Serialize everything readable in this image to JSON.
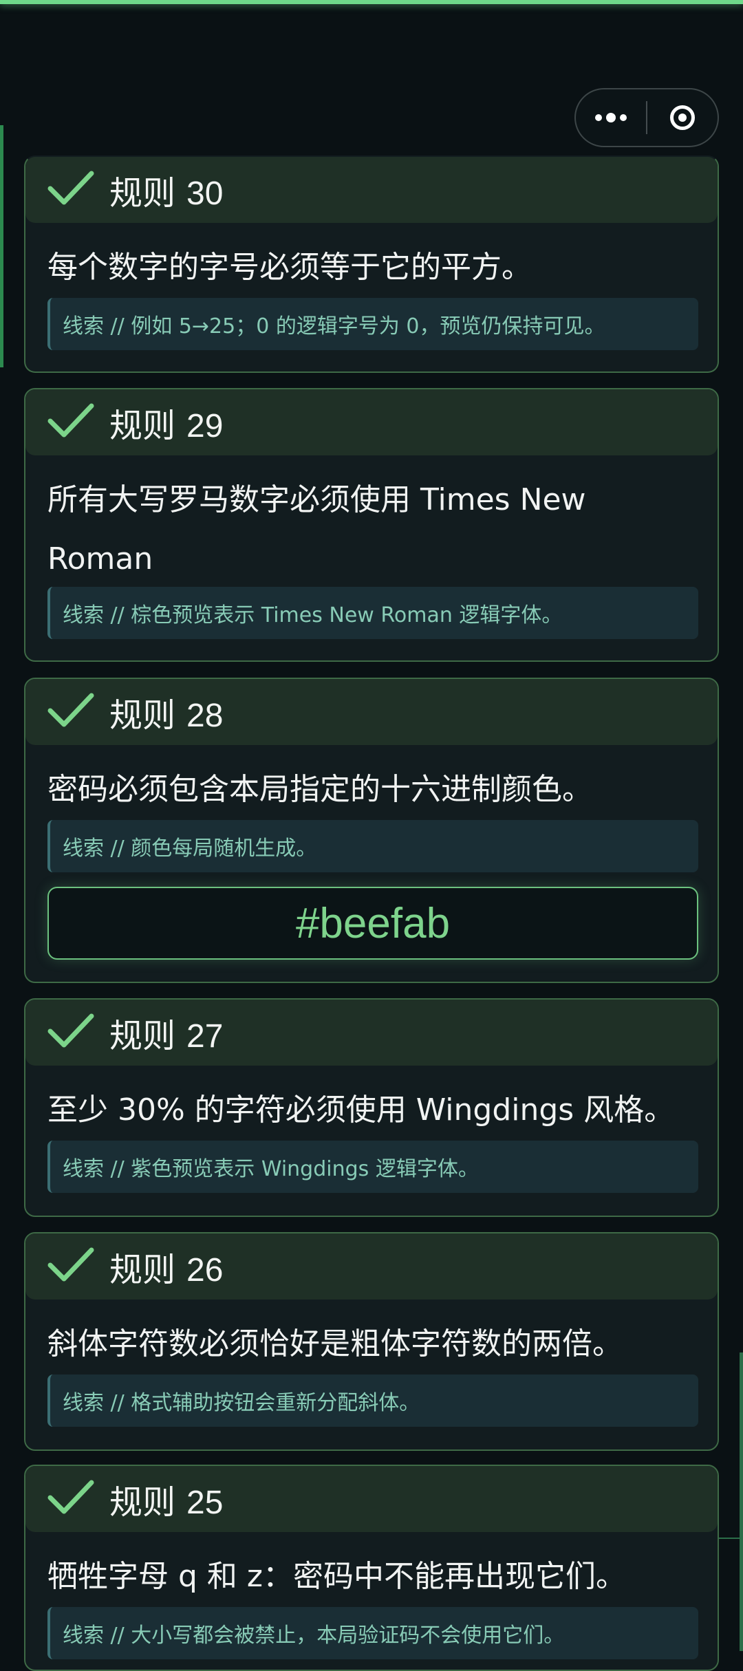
{
  "menu": {
    "more_icon": "more-dots-icon",
    "close_icon": "target-circle-icon"
  },
  "colors": {
    "accent": "#6fd98a",
    "card_bg": "#121c1f",
    "header_bg": "#1f3026",
    "clue_text": "#88cbb6"
  },
  "rules": [
    {
      "label": "规则",
      "number": "30",
      "text": "每个数字的字号必须等于它的平方。",
      "clue": "线索 // 例如 5→25；0 的逻辑字号为 0，预览仍保持可见。"
    },
    {
      "label": "规则",
      "number": "29",
      "text": "所有大写罗马数字必须使用 Times New Roman",
      "text_cont": "。",
      "clue": "线索 // 棕色预览表示 Times New Roman 逻辑字体。"
    },
    {
      "label": "规则",
      "number": "28",
      "text": "密码必须包含本局指定的十六进制颜色。",
      "clue": "线索 // 颜色每局随机生成。",
      "color_hex": "#beefab"
    },
    {
      "label": "规则",
      "number": "27",
      "text": "至少 30% 的字符必须使用 Wingdings 风格。",
      "clue": "线索 // 紫色预览表示 Wingdings 逻辑字体。"
    },
    {
      "label": "规则",
      "number": "26",
      "text": "斜体字符数必须恰好是粗体字符数的两倍。",
      "clue": "线索 // 格式辅助按钮会重新分配斜体。"
    },
    {
      "label": "规则",
      "number": "25",
      "text": "牺牲字母 q 和 z：密码中不能再出现它们。",
      "clue": "线索 // 大小写都会被禁止，本局验证码不会使用它们。"
    }
  ]
}
